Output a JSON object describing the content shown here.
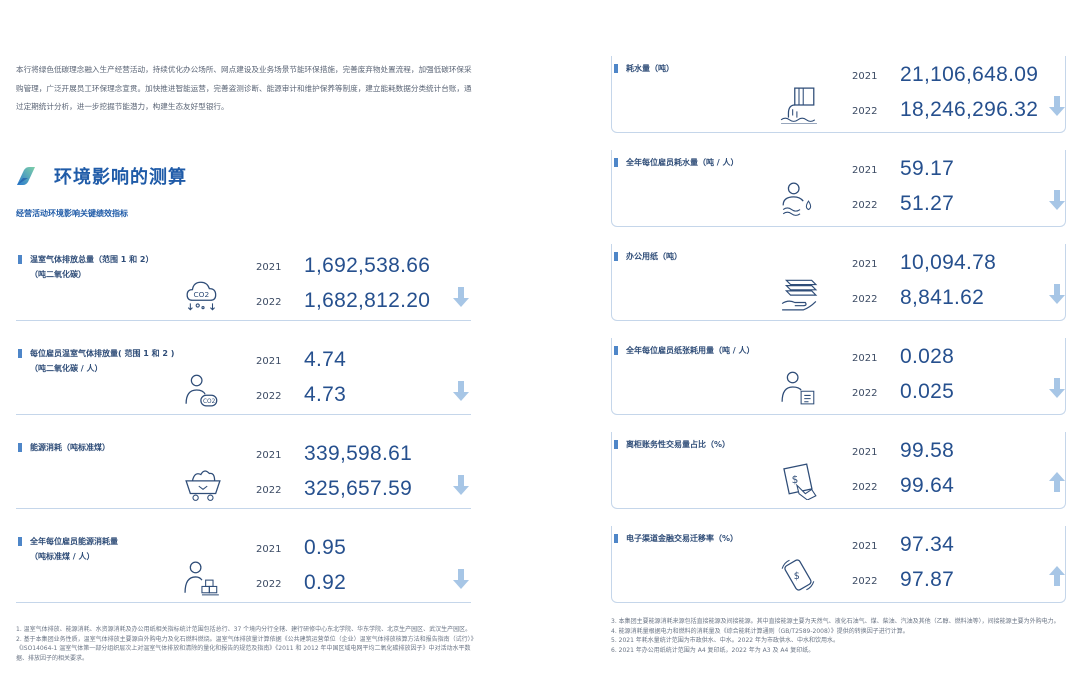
{
  "intro": "本行将绿色低碳理念融入生产经营活动，持续优化办公场所、网点建设及业务场景节能环保措施，完善废弃物处置流程，加强低碳环保采购管理，广泛开展员工环保理念宣贯。加快推进智能运营，完善盗测诊断、能源审计和维护保养等制度，建立能耗数据分类统计台账，通过定期统计分析，进一步挖掘节能潜力，构建生态友好型银行。",
  "section_title": "环境影响的测算",
  "subhead": "经营活动环境影响关键绩效指标",
  "left_cards": [
    {
      "label": "温室气体排放总量（范围 1 和 2）",
      "sub": "（吨二氧化碳）",
      "y1": "2021",
      "v1": "1,692,538.66",
      "y2": "2022",
      "v2": "1,682,812.20",
      "trend": "down",
      "icon": "co2-cloud-icon"
    },
    {
      "label": "每位雇员温室气体排放量( 范围 1 和 2 )",
      "sub": "（吨二氧化碳 / 人）",
      "y1": "2021",
      "v1": "4.74",
      "y2": "2022",
      "v2": "4.73",
      "trend": "down",
      "icon": "person-co2-icon"
    },
    {
      "label": "能源消耗（吨标准煤）",
      "sub": "",
      "y1": "2021",
      "v1": "339,598.61",
      "y2": "2022",
      "v2": "325,657.59",
      "trend": "down",
      "icon": "coal-cart-icon"
    },
    {
      "label": "全年每位雇员能源消耗量",
      "sub": "（吨标准煤 / 人）",
      "y1": "2021",
      "v1": "0.95",
      "y2": "2022",
      "v2": "0.92",
      "trend": "down",
      "icon": "person-coal-icon"
    }
  ],
  "right_cards": [
    {
      "label": "耗水量（吨）",
      "sub": "",
      "y1": "2021",
      "v1": "21,106,648.09",
      "y2": "2022",
      "v2": "18,246,296.32",
      "trend": "down",
      "icon": "water-pipe-icon"
    },
    {
      "label": "全年每位雇员耗水量（吨 / 人）",
      "sub": "",
      "y1": "2021",
      "v1": "59.17",
      "y2": "2022",
      "v2": "51.27",
      "trend": "down",
      "icon": "person-water-icon"
    },
    {
      "label": "办公用纸（吨）",
      "sub": "",
      "y1": "2021",
      "v1": "10,094.78",
      "y2": "2022",
      "v2": "8,841.62",
      "trend": "down",
      "icon": "paper-stack-icon"
    },
    {
      "label": "全年每位雇员纸张耗用量（吨 / 人）",
      "sub": "",
      "y1": "2021",
      "v1": "0.028",
      "y2": "2022",
      "v2": "0.025",
      "trend": "down",
      "icon": "person-paper-icon"
    },
    {
      "label": "离柜账务性交易量占比（%）",
      "sub": "",
      "y1": "2021",
      "v1": "99.58",
      "y2": "2022",
      "v2": "99.64",
      "trend": "up",
      "icon": "touch-screen-icon"
    },
    {
      "label": "电子渠道金融交易迁移率（%）",
      "sub": "",
      "y1": "2021",
      "v1": "97.34",
      "y2": "2022",
      "v2": "97.87",
      "trend": "up",
      "icon": "mobile-pay-icon"
    }
  ],
  "footnotes_left": [
    "1. 温室气体排放、能源消耗、水资源消耗及办公用纸相关指标统计范围包括总行、37 个境内分行全辖、建行研修中心东北学院、华东学院、北京生产园区、武汉生产园区。",
    "2. 基于本集团业务性质，温室气体排放主要源自外购电力及化石燃料燃烧。温室气体排放量计算依据《公共建筑运营单位（企业）温室气体排放核算方法和报告指南（试行）》《ISO14064-1 温室气体第一部分组织层次上对温室气体排放和清除的量化和报告的规范及指南》《2011 和 2012 年中国区域电网平均二氧化碳排放因子》中对活动水平数据、排放因子的相关要求。"
  ],
  "footnotes_right": [
    "3. 本集团主要能源消耗来源包括直接能源及间接能源。其中直接能源主要为天然气、液化石油气、煤、柴油、汽油及其他（乙醇、燃料油等），间接能源主要为外购电力。",
    "4. 能源消耗量根据电力和燃料的消耗量及《综合能耗计算通则（GB/T2589-2008）》提供的转换因子进行计算。",
    "5. 2021 年耗水量统计范围为市政供水、中水。2022 年为市政供水、中水和饮用水。",
    "6. 2021 年办公用纸统计范围为 A4 复印纸，2022 年为 A3 及 A4 复印纸。"
  ],
  "colors": {
    "accent": "#1f5ba8",
    "value": "#26508e",
    "arrow": "#a7c6e6",
    "border": "#c5d6ea"
  }
}
